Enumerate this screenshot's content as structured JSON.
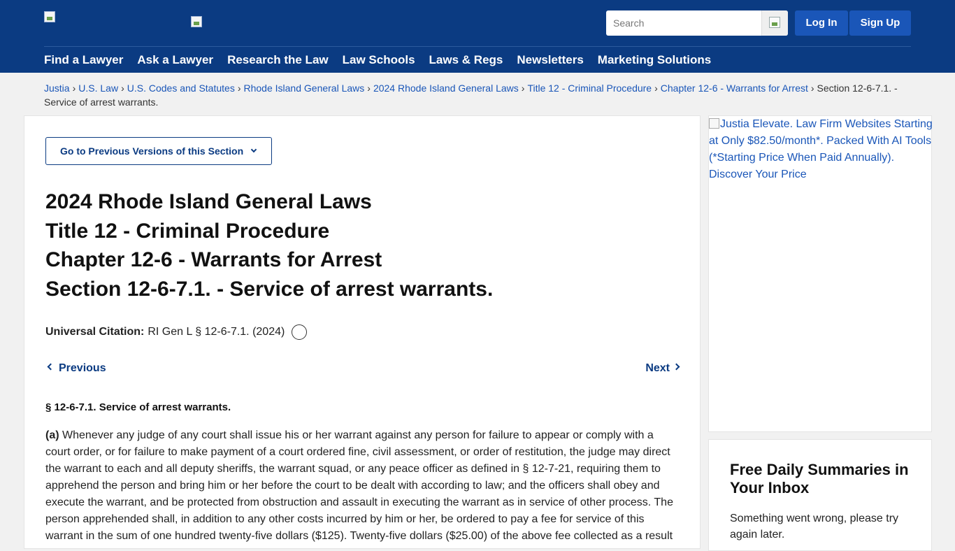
{
  "header": {
    "search_placeholder": "Search",
    "login_label": "Log In",
    "signup_label": "Sign Up",
    "nav": [
      "Find a Lawyer",
      "Ask a Lawyer",
      "Research the Law",
      "Law Schools",
      "Laws & Regs",
      "Newsletters",
      "Marketing Solutions"
    ]
  },
  "breadcrumb": {
    "links": [
      "Justia",
      "U.S. Law",
      "U.S. Codes and Statutes",
      "Rhode Island General Laws",
      "2024 Rhode Island General Laws",
      "Title 12 - Criminal Procedure",
      "Chapter 12-6 - Warrants for Arrest"
    ],
    "separator": "›",
    "current": "Section 12-6-7.1. - Service of arrest warrants."
  },
  "main": {
    "prev_versions_label": "Go to Previous Versions of this Section",
    "titles": [
      "2024 Rhode Island General Laws",
      "Title 12 - Criminal Procedure",
      "Chapter 12-6 - Warrants for Arrest",
      "Section 12-6-7.1. - Service of arrest warrants."
    ],
    "citation_label": "Universal Citation:",
    "citation_value": "RI Gen L § 12-6-7.1. (2024)",
    "previous_label": "Previous",
    "next_label": "Next",
    "section_heading": "§ 12-6-7.1. Service of arrest warrants.",
    "para_a_label": "(a)",
    "para_a_text": "Whenever any judge of any court shall issue his or her warrant against any person for failure to appear or comply with a court order, or for failure to make payment of a court ordered fine, civil assessment, or order of restitution, the judge may direct the warrant to each and all deputy sheriffs, the warrant squad, or any peace officer as defined in § 12-7-21, requiring them to apprehend the person and bring him or her before the court to be dealt with according to law; and the officers shall obey and execute the warrant, and be protected from obstruction and assault in executing the warrant as in service of other process. The person apprehended shall, in addition to any other costs incurred by him or her, be ordered to pay a fee for service of this warrant in the sum of one hundred twenty-five dollars ($125). Twenty-five dollars ($25.00) of the above fee collected as a result"
  },
  "sidebar": {
    "ad_alt": "Justia Elevate. Law Firm Websites Starting at Only $82.50/month*. Packed With AI Tools (*Starting Price When Paid Annually). Discover Your Price",
    "newsletter_title": "Free Daily Summaries in Your Inbox",
    "newsletter_error": "Something went wrong, please try again later."
  },
  "colors": {
    "header_bg": "#0b3b82",
    "link": "#1a56b8",
    "button_bg": "#1a56b8"
  }
}
